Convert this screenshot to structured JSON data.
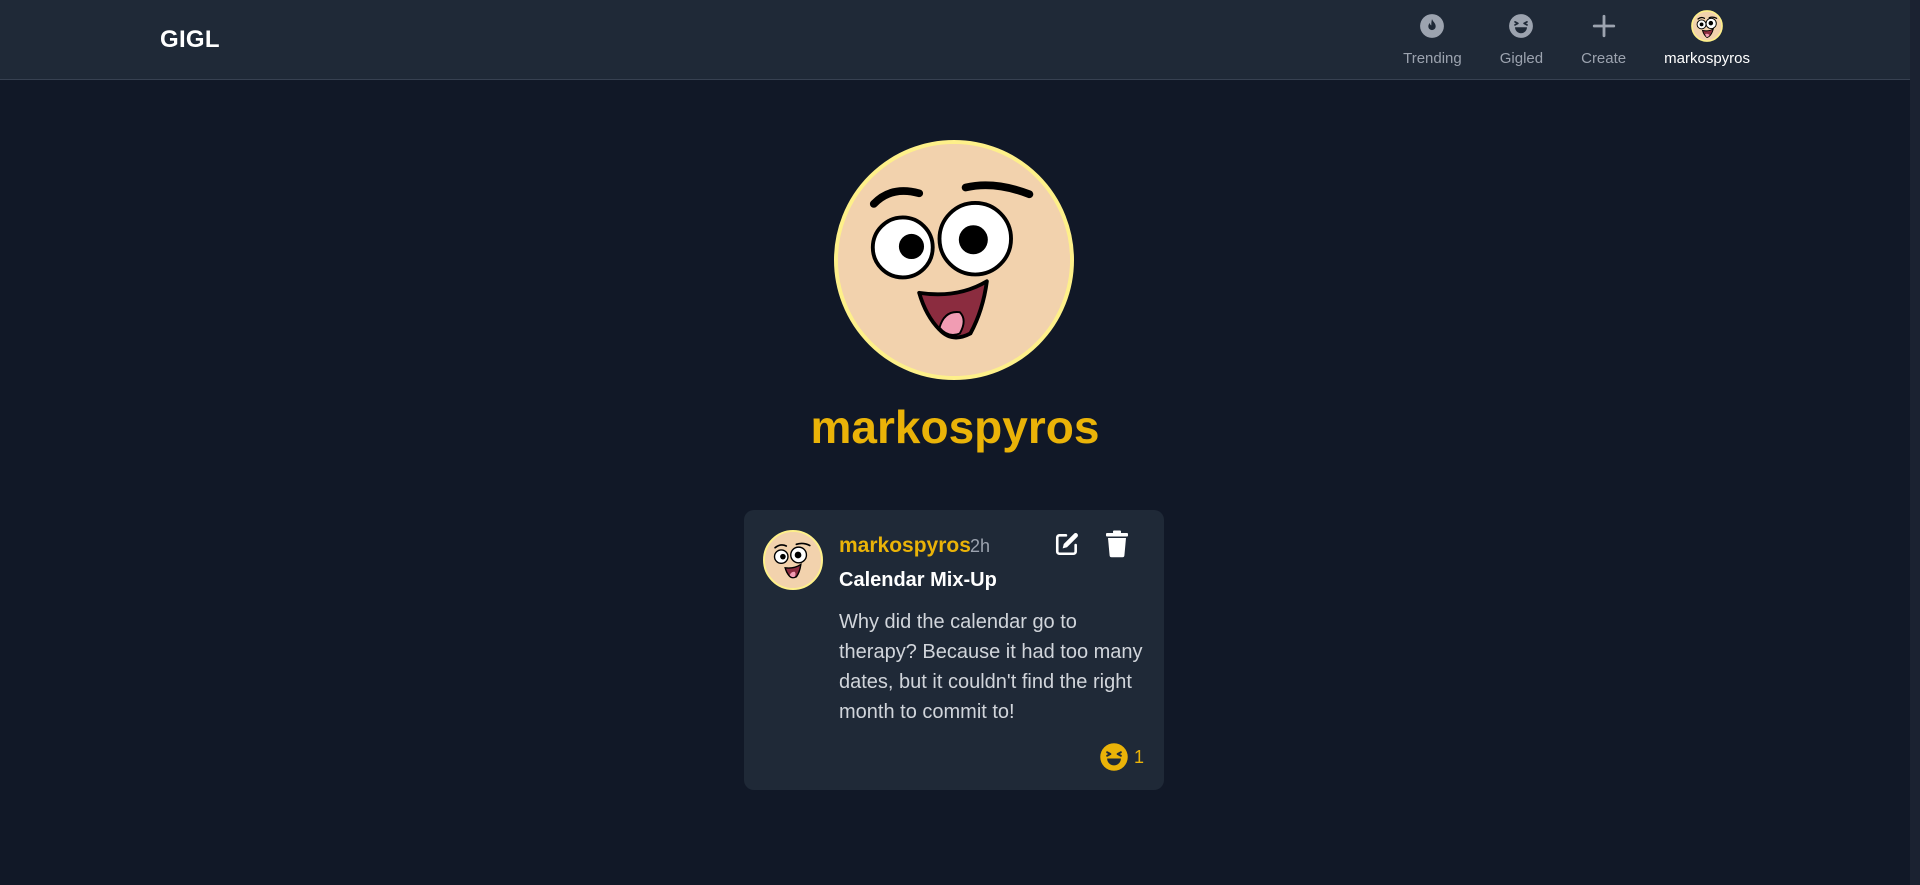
{
  "app": {
    "brand": "GIGL"
  },
  "nav": {
    "items": [
      {
        "label": "Trending",
        "icon": "flame-icon"
      },
      {
        "label": "Gigled",
        "icon": "laughing-face-icon"
      },
      {
        "label": "Create",
        "icon": "plus-icon"
      },
      {
        "label": "markospyros",
        "icon": "user-avatar"
      }
    ]
  },
  "profile": {
    "username": "markospyros"
  },
  "post": {
    "author": "markospyros",
    "time": "2h",
    "title": "Calendar Mix-Up",
    "body": "Why did the calendar go to therapy? Because it had too many dates, but it couldn't find the right month to commit to!",
    "reaction_count": "1",
    "reaction_icon": "laughing-face-icon"
  },
  "colors": {
    "background": "#111827",
    "navbar": "#1f2937",
    "card": "#1f2937",
    "accent": "#eab308",
    "avatar_ring": "#fef08a"
  }
}
